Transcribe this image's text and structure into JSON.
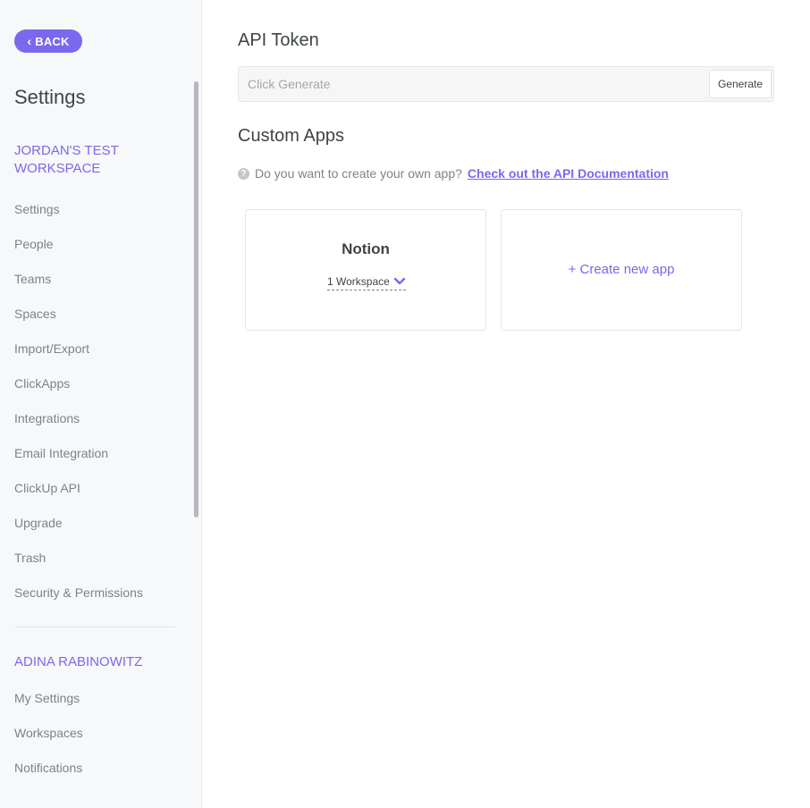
{
  "sidebar": {
    "back_label": "BACK",
    "title": "Settings",
    "workspace_heading": "JORDAN'S TEST WORKSPACE",
    "workspace_items": [
      "Settings",
      "People",
      "Teams",
      "Spaces",
      "Import/Export",
      "ClickApps",
      "Integrations",
      "Email Integration",
      "ClickUp API",
      "Upgrade",
      "Trash",
      "Security & Permissions"
    ],
    "user_heading": "ADINA RABINOWITZ",
    "user_items": [
      "My Settings",
      "Workspaces",
      "Notifications"
    ]
  },
  "main": {
    "api_token_heading": "API Token",
    "token_placeholder": "Click Generate",
    "generate_label": "Generate",
    "custom_apps_heading": "Custom Apps",
    "help_icon": "?",
    "help_text": "Do you want to create your own app?",
    "help_link": "Check out the API Documentation",
    "apps": [
      {
        "name": "Notion",
        "workspaces_label": "1 Workspace"
      }
    ],
    "create_new_label": "+ Create new app"
  },
  "colors": {
    "accent": "#7b68ee",
    "sidebar_bg": "#f7f8f9",
    "muted_text": "#7c828d"
  }
}
